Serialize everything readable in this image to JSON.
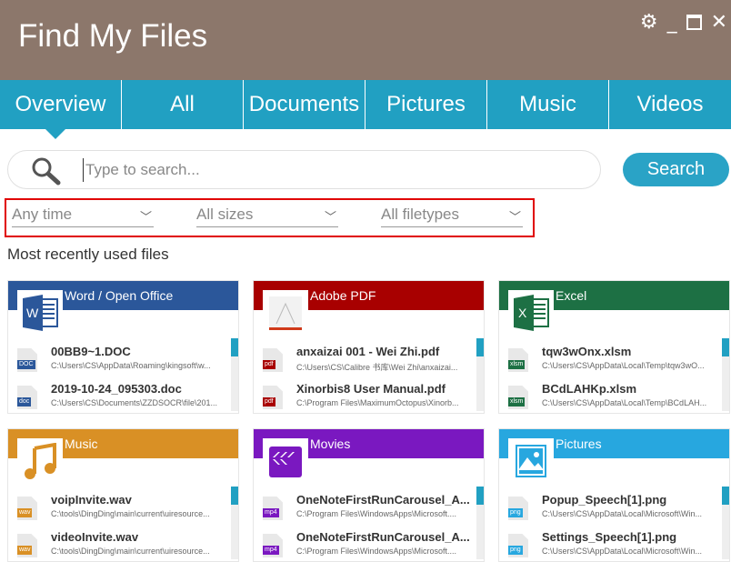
{
  "app": {
    "title": "Find My Files",
    "icons": [
      "gear-icon",
      "minimize-icon",
      "maximize-icon",
      "close-icon"
    ]
  },
  "tabs": [
    {
      "label": "Overview",
      "active": true
    },
    {
      "label": "All"
    },
    {
      "label": "Documents"
    },
    {
      "label": "Pictures"
    },
    {
      "label": "Music"
    },
    {
      "label": "Videos"
    }
  ],
  "search": {
    "placeholder": "Type to search...",
    "value": "",
    "button": "Search"
  },
  "filters": {
    "time": "Any time",
    "size": "All sizes",
    "type": "All filetypes"
  },
  "section_title": "Most recently used files",
  "cards": [
    {
      "title": "Word / Open Office",
      "color": "#2b579a",
      "icon": "word-icon",
      "files": [
        {
          "name": "00BB9~1.DOC",
          "path": "C:\\Users\\CS\\AppData\\Roaming\\kingsoft\\w...",
          "tag": "DOC"
        },
        {
          "name": "2019-10-24_095303.doc",
          "path": "C:\\Users\\CS\\Documents\\ZZDSOCR\\file\\201...",
          "tag": "doc"
        }
      ]
    },
    {
      "title": "Adobe PDF",
      "color": "#a80000",
      "icon": "pdf-icon",
      "files": [
        {
          "name": "anxaizai 001 - Wei Zhi.pdf",
          "path": "C:\\Users\\CS\\Calibre 书库\\Wei Zhi\\anxaizai...",
          "tag": "pdf"
        },
        {
          "name": "Xinorbis8 User Manual.pdf",
          "path": "C:\\Program Files\\MaximumOctopus\\Xinorb...",
          "tag": "pdf"
        }
      ]
    },
    {
      "title": "Excel",
      "color": "#1d7044",
      "icon": "excel-icon",
      "files": [
        {
          "name": "tqw3wOnx.xlsm",
          "path": "C:\\Users\\CS\\AppData\\Local\\Temp\\tqw3wO...",
          "tag": "xlsm"
        },
        {
          "name": "BCdLAHKp.xlsm",
          "path": "C:\\Users\\CS\\AppData\\Local\\Temp\\BCdLAH...",
          "tag": "xlsm"
        }
      ]
    },
    {
      "title": "Music",
      "color": "#d99025",
      "icon": "music-note-icon",
      "files": [
        {
          "name": "voipInvite.wav",
          "path": "C:\\tools\\DingDing\\main\\current\\uiresource...",
          "tag": "wav"
        },
        {
          "name": "videoInvite.wav",
          "path": "C:\\tools\\DingDing\\main\\current\\uiresource...",
          "tag": "wav"
        }
      ]
    },
    {
      "title": "Movies",
      "color": "#7a18c0",
      "icon": "clapperboard-icon",
      "files": [
        {
          "name": "OneNoteFirstRunCarousel_A...",
          "path": "C:\\Program Files\\WindowsApps\\Microsoft....",
          "tag": "mp4"
        },
        {
          "name": "OneNoteFirstRunCarousel_A...",
          "path": "C:\\Program Files\\WindowsApps\\Microsoft....",
          "tag": "mp4"
        }
      ]
    },
    {
      "title": "Pictures",
      "color": "#27a7df",
      "icon": "picture-icon",
      "files": [
        {
          "name": "Popup_Speech[1].png",
          "path": "C:\\Users\\CS\\AppData\\Local\\Microsoft\\Win...",
          "tag": "png"
        },
        {
          "name": "Settings_Speech[1].png",
          "path": "C:\\Users\\CS\\AppData\\Local\\Microsoft\\Win...",
          "tag": "png"
        }
      ]
    }
  ]
}
